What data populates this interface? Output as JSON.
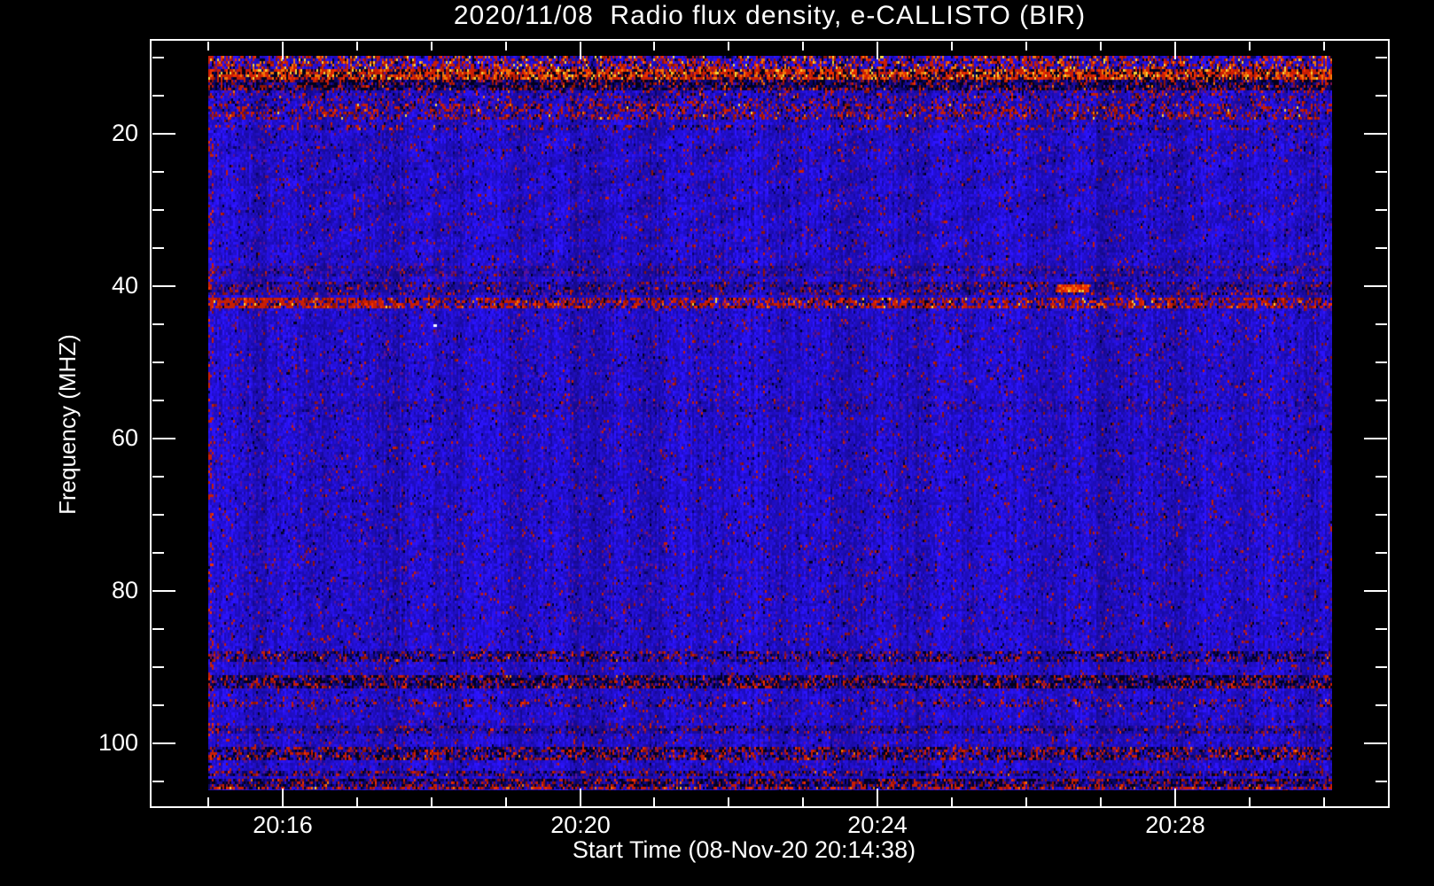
{
  "title": "2020/11/08  Radio flux density, e-CALLISTO (BIR)",
  "chart_data": {
    "type": "heatmap",
    "title": "2020/11/08  Radio flux density, e-CALLISTO (BIR)",
    "xlabel": "Start Time (08-Nov-20 20:14:38)",
    "ylabel": "Frequency (MHZ)",
    "start_time_text": "08-Nov-20 20:14:38",
    "x_axis": {
      "ticks": [
        {
          "label": "20:16",
          "t": 0
        },
        {
          "label": "20:20",
          "t": 4
        },
        {
          "label": "20:24",
          "t": 8
        },
        {
          "label": "20:28",
          "t": 12
        }
      ],
      "minor_tick_minutes": [
        -1,
        1,
        2,
        3,
        5,
        6,
        7,
        9,
        10,
        11,
        13,
        14
      ],
      "range_minutes_rel_2016": [
        -1.775,
        14.875
      ]
    },
    "y_axis": {
      "ticks": [
        {
          "label": "20",
          "f": 20
        },
        {
          "label": "40",
          "f": 40
        },
        {
          "label": "60",
          "f": 60
        },
        {
          "label": "80",
          "f": 80
        },
        {
          "label": "100",
          "f": 100
        }
      ],
      "minor_tick_mhz": [
        10,
        15,
        25,
        30,
        35,
        45,
        50,
        55,
        65,
        70,
        75,
        85,
        90,
        95,
        105
      ],
      "range_mhz": [
        7.67,
        108.5
      ],
      "direction": "increasing-downward"
    },
    "data_extent": {
      "f_top_mhz": 9.76,
      "f_bottom_mhz": 106.2,
      "t_start_min_rel_2016": -1.0,
      "t_end_min_rel_2016": 14.11
    },
    "bands": [
      {
        "f0": 9.76,
        "f1": 11.6,
        "style": "hot_mix"
      },
      {
        "f0": 11.6,
        "f1": 12.8,
        "style": "hot_core"
      },
      {
        "f0": 12.8,
        "f1": 14.2,
        "style": "dark_band"
      },
      {
        "f0": 14.2,
        "f1": 16.1,
        "style": "speckle_mild"
      },
      {
        "f0": 16.1,
        "f1": 18.2,
        "style": "red_row_mild"
      },
      {
        "f0": 18.8,
        "f1": 19.4,
        "style": "speckle_mild"
      },
      {
        "f0": 21.6,
        "f1": 22.2,
        "style": "speckle_faint"
      },
      {
        "f0": 37.2,
        "f1": 38.8,
        "style": "purple_tint"
      },
      {
        "f0": 39.4,
        "f1": 41.0,
        "style": "faint_dark"
      },
      {
        "f0": 41.6,
        "f1": 43.0,
        "style": "red_row"
      },
      {
        "f0": 55.0,
        "f1": 56.5,
        "style": "purple_tint_faint"
      },
      {
        "f0": 87.9,
        "f1": 89.2,
        "style": "dark_speckle"
      },
      {
        "f0": 91.2,
        "f1": 92.8,
        "style": "dark_speckle_strong"
      },
      {
        "f0": 94.2,
        "f1": 95.4,
        "style": "speckle_mild"
      },
      {
        "f0": 97.8,
        "f1": 98.8,
        "style": "faint_dark"
      },
      {
        "f0": 100.4,
        "f1": 102.1,
        "style": "dark_speckle_red"
      },
      {
        "f0": 103.6,
        "f1": 104.5,
        "style": "dark_speckle"
      },
      {
        "f0": 104.8,
        "f1": 105.6,
        "style": "dark_speckle_strong"
      },
      {
        "f0": 105.6,
        "f1": 106.2,
        "style": "red_bottom"
      }
    ],
    "events": [
      {
        "t0": 10.42,
        "t1": 10.85,
        "f0": 39.6,
        "f1": 40.9,
        "style": "hotspot"
      },
      {
        "t0": -1.0,
        "t1": 1.35,
        "f0": 41.6,
        "f1": 43.0,
        "style": "red_boost"
      },
      {
        "t0": -1.0,
        "t1": -0.93,
        "f0": 9.76,
        "f1": 106.2,
        "style": "red_boost"
      },
      {
        "t0": 2.02,
        "t1": 2.08,
        "f0": 44.9,
        "f1": 45.4,
        "style": "white_dot"
      }
    ],
    "palette": {
      "background": "#000000",
      "frame": "#ffffff",
      "text": "#ffffff",
      "blue_bright": "#2b14f5",
      "blue_mid": "#2210d2",
      "blue_dim": "#1a0ba8",
      "purple": "#5a1198",
      "magenta_dark": "#7c1048",
      "navy": "#0a0464",
      "black": "#02001e",
      "red": "#c81e05",
      "red_bright": "#f03000",
      "red_dark": "#8c1405",
      "orange": "#f07808",
      "yellow": "#f5d437",
      "white": "#ffffff"
    }
  }
}
